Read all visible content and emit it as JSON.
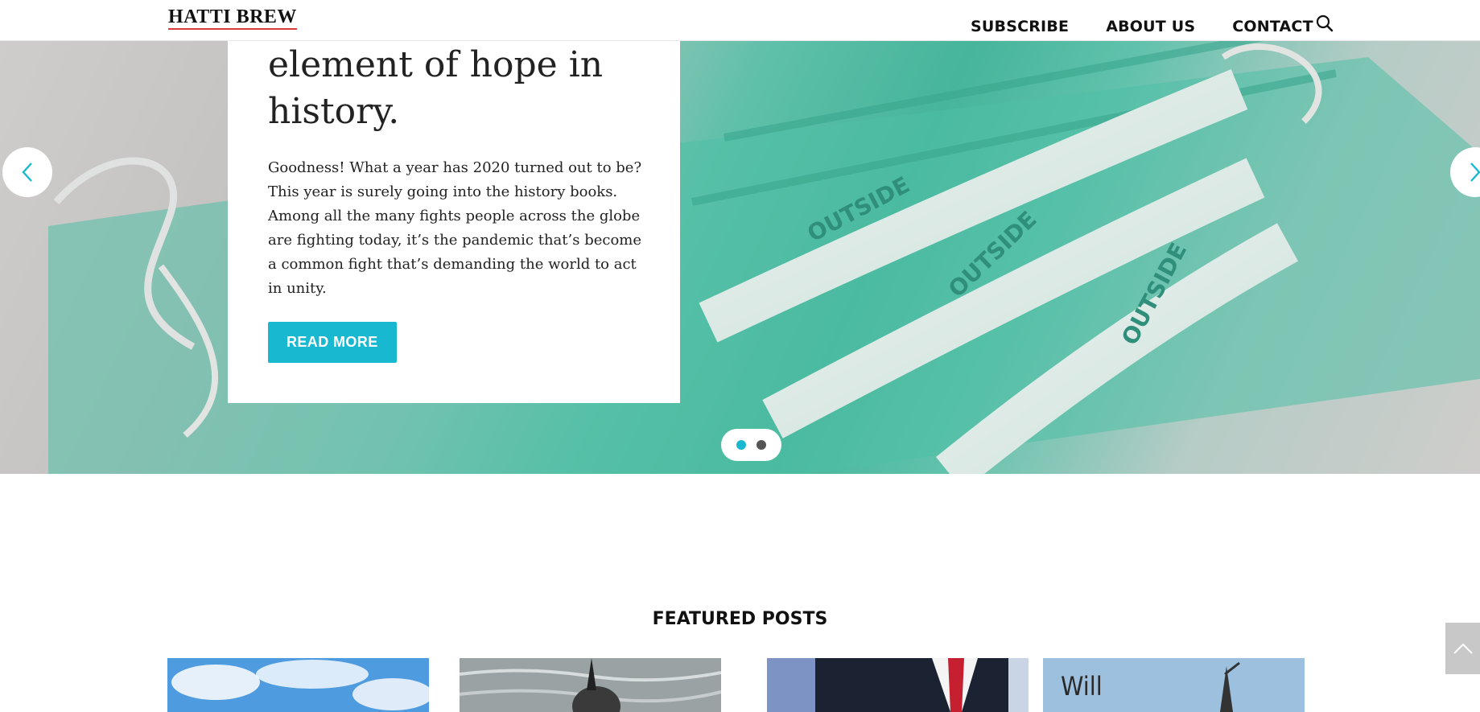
{
  "header": {
    "logo": "HATTI BREW",
    "nav": [
      {
        "label": "SUBSCRIBE"
      },
      {
        "label": "ABOUT US"
      },
      {
        "label": "CONTACT"
      }
    ],
    "search_icon": "search-icon"
  },
  "hero": {
    "title_line1": "element of hope in",
    "title_line2": "history.",
    "excerpt": "Goodness! What a year has 2020 turned out to be? This year is surely going into the history books. Among all the many fights people across the globe are fighting today, it’s the pandemic that’s become a common fight that’s demanding the world to act in unity.",
    "read_more": "READ MORE",
    "mask_text": [
      "OUTSIDE",
      "OUTSIDE",
      "OUTSIDE"
    ],
    "slides": 2,
    "active_slide": 1,
    "accent": "#17b8d0"
  },
  "featured": {
    "title": "FEATURED POSTS",
    "posts": [
      {
        "image": "sky-clouds"
      },
      {
        "image": "water-bird"
      },
      {
        "image": "suit-tie"
      },
      {
        "image": "sky-text",
        "caption": "Will"
      }
    ]
  },
  "scroll_top_icon": "chevron-up-icon"
}
